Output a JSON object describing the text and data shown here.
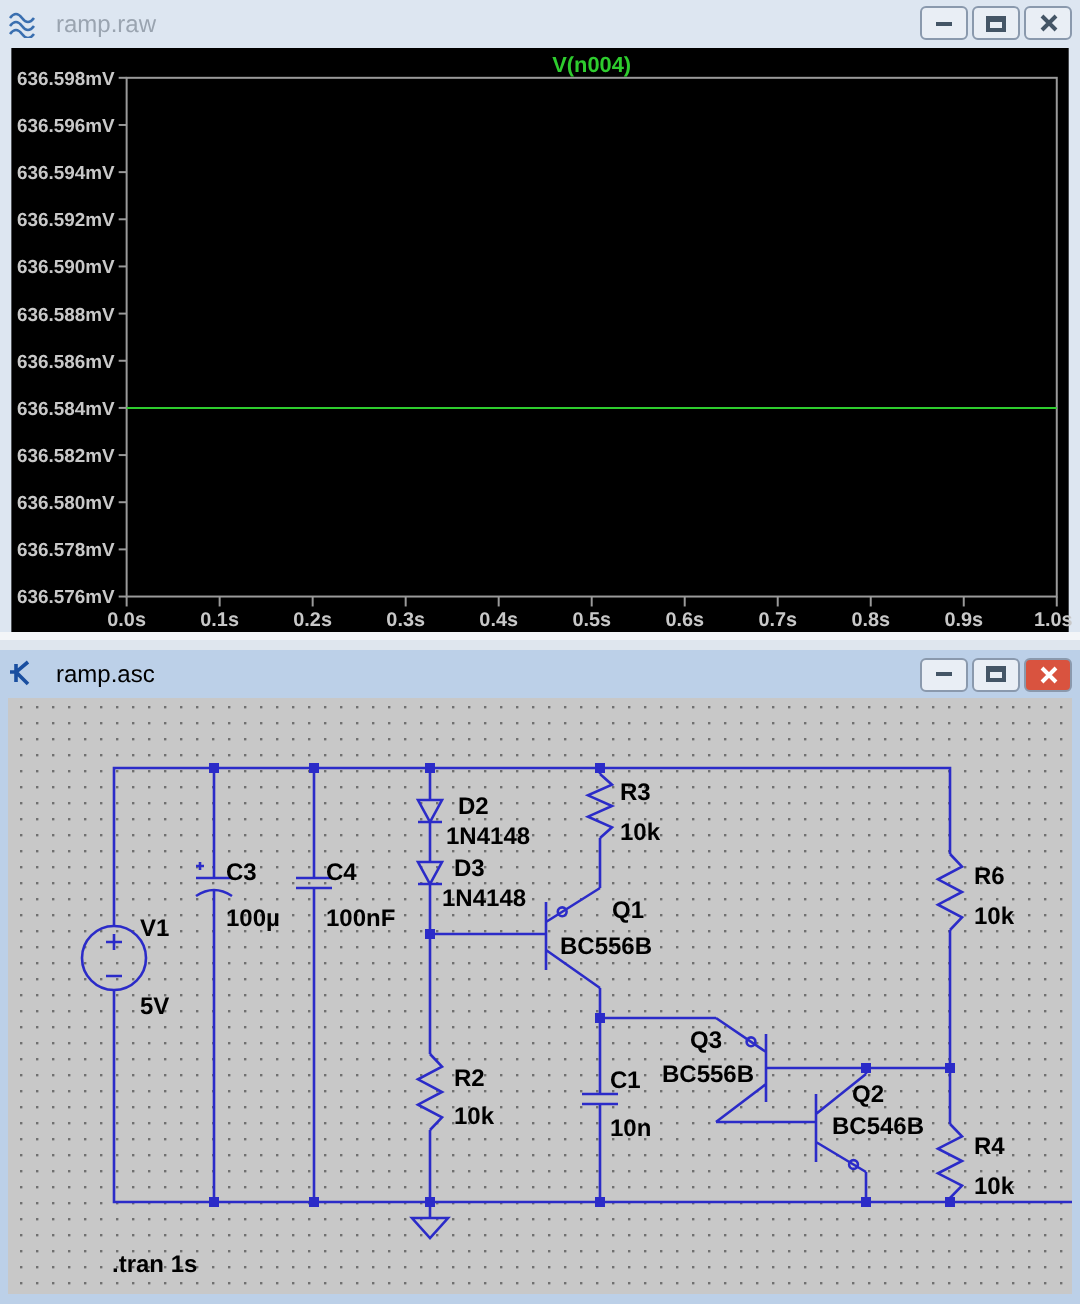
{
  "windows": [
    {
      "title": "ramp.raw",
      "active": false,
      "kind": "waveform",
      "plot": {
        "chart_data": {
          "type": "line",
          "x": [
            0,
            1
          ],
          "xlim": [
            0,
            1
          ],
          "ylim": [
            636.576,
            636.598
          ],
          "xticks": [
            {
              "value": 0,
              "label": "0.0s"
            },
            {
              "value": 0.1,
              "label": "0.1s"
            },
            {
              "value": 0.2,
              "label": "0.2s"
            },
            {
              "value": 0.3,
              "label": "0.3s"
            },
            {
              "value": 0.4,
              "label": "0.4s"
            },
            {
              "value": 0.5,
              "label": "0.5s"
            },
            {
              "value": 0.6,
              "label": "0.6s"
            },
            {
              "value": 0.7,
              "label": "0.7s"
            },
            {
              "value": 0.8,
              "label": "0.8s"
            },
            {
              "value": 0.9,
              "label": "0.9s"
            },
            {
              "value": 1,
              "label": "1.0s"
            }
          ],
          "yticks": [
            {
              "value": 636.598,
              "label": "636.598mV"
            },
            {
              "value": 636.596,
              "label": "636.596mV"
            },
            {
              "value": 636.594,
              "label": "636.594mV"
            },
            {
              "value": 636.592,
              "label": "636.592mV"
            },
            {
              "value": 636.59,
              "label": "636.590mV"
            },
            {
              "value": 636.588,
              "label": "636.588mV"
            },
            {
              "value": 636.586,
              "label": "636.586mV"
            },
            {
              "value": 636.584,
              "label": "636.584mV"
            },
            {
              "value": 636.582,
              "label": "636.582mV"
            },
            {
              "value": 636.58,
              "label": "636.580mV"
            },
            {
              "value": 636.578,
              "label": "636.578mV"
            },
            {
              "value": 636.576,
              "label": "636.576mV"
            }
          ],
          "series": [
            {
              "name": "V(n004)",
              "color": "#2ecc2e",
              "values": [
                636.584,
                636.584
              ]
            }
          ]
        }
      }
    },
    {
      "title": "ramp.asc",
      "active": true,
      "kind": "schematic",
      "schematic": {
        "components": [
          {
            "kind": "voltage_source",
            "ref": "V1",
            "value": "5V"
          },
          {
            "kind": "polarized_capacitor",
            "ref": "C3",
            "value": "100µ"
          },
          {
            "kind": "capacitor",
            "ref": "C4",
            "value": "100nF"
          },
          {
            "kind": "diode",
            "ref": "D2",
            "value": "1N4148"
          },
          {
            "kind": "diode",
            "ref": "D3",
            "value": "1N4148"
          },
          {
            "kind": "resistor",
            "ref": "R3",
            "value": "10k"
          },
          {
            "kind": "pnp",
            "ref": "Q1",
            "value": "BC556B"
          },
          {
            "kind": "resistor",
            "ref": "R2",
            "value": "10k"
          },
          {
            "kind": "capacitor",
            "ref": "C1",
            "value": "10n"
          },
          {
            "kind": "pnp",
            "ref": "Q3",
            "value": "BC556B"
          },
          {
            "kind": "npn",
            "ref": "Q2",
            "value": "BC546B"
          },
          {
            "kind": "resistor",
            "ref": "R6",
            "value": "10k"
          },
          {
            "kind": "resistor",
            "ref": "R4",
            "value": "10k"
          }
        ],
        "directive": ".tran 1s"
      }
    }
  ]
}
